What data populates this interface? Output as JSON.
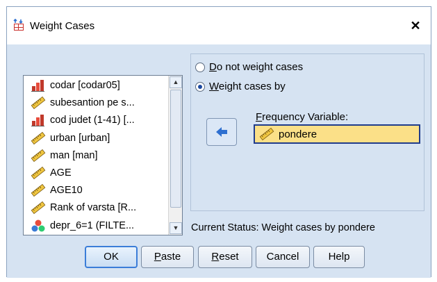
{
  "window": {
    "title": "Weight Cases",
    "close_glyph": "✕"
  },
  "variables": [
    {
      "label": "codar [codar05]",
      "icon": "nominal-icon"
    },
    {
      "label": "subesantion pe s...",
      "icon": "scale-icon"
    },
    {
      "label": "cod judet (1-41) [...",
      "icon": "nominal-icon"
    },
    {
      "label": "urban [urban]",
      "icon": "scale-icon"
    },
    {
      "label": "man [man]",
      "icon": "scale-icon"
    },
    {
      "label": "AGE",
      "icon": "scale-icon"
    },
    {
      "label": "AGE10",
      "icon": "scale-icon"
    },
    {
      "label": "Rank of varsta [R...",
      "icon": "scale-icon"
    },
    {
      "label": "depr_6=1 (FILTE...",
      "icon": "filter-icon"
    }
  ],
  "options": {
    "do_not_weight": {
      "mnemonic": "D",
      "rest": "o not weight cases",
      "selected": false
    },
    "weight_by": {
      "mnemonic": "W",
      "rest": "eight cases by",
      "selected": true
    }
  },
  "frequency": {
    "label_mnemonic": "F",
    "label_rest": "requency Variable:",
    "value": "pondere"
  },
  "status": "Current Status: Weight cases by pondere",
  "buttons": {
    "ok": "OK",
    "paste_mn": "P",
    "paste_rest": "aste",
    "reset_mn": "R",
    "reset_rest": "eset",
    "cancel": "Cancel",
    "help": "Help"
  },
  "colors": {
    "dialog_bg": "#d6e3f2",
    "field_highlight": "#fbe088",
    "field_border": "#1f3b8c",
    "accent_arrow": "#2e6fd0"
  }
}
